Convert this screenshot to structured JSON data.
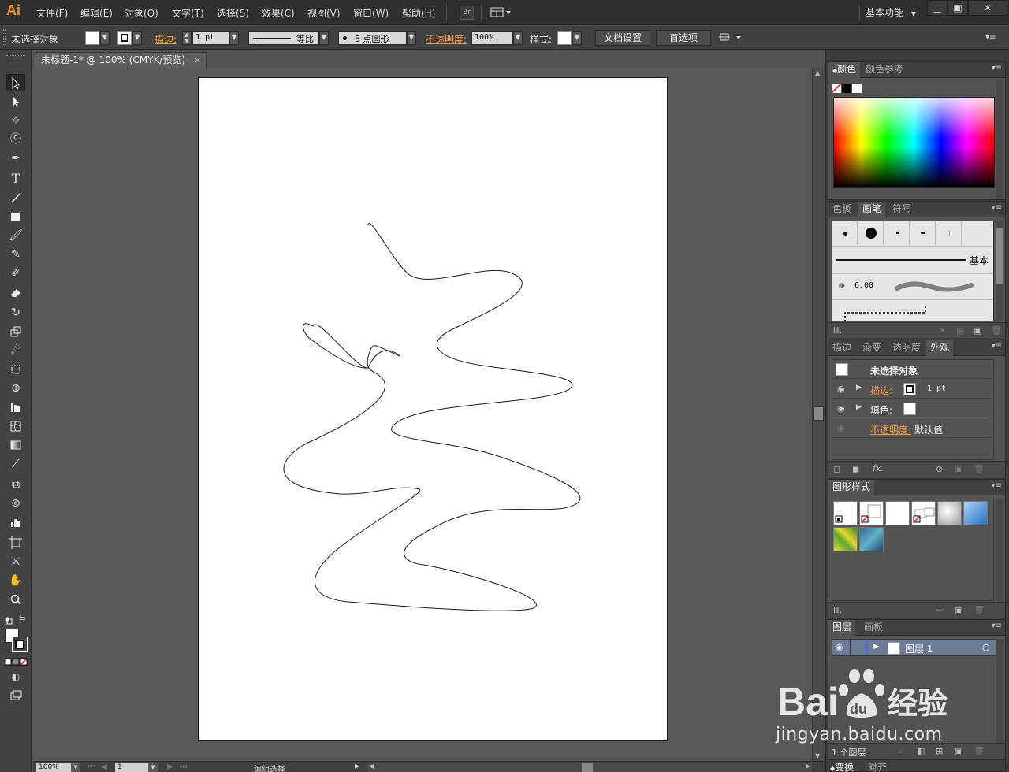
{
  "app": {
    "logo": "Ai",
    "menu": [
      "文件(F)",
      "编辑(E)",
      "对象(O)",
      "文字(T)",
      "选择(S)",
      "效果(C)",
      "视图(V)",
      "窗口(W)",
      "帮助(H)"
    ],
    "bridge_button": "Br",
    "workspace": "基本功能",
    "window_controls": [
      "▁",
      "▣",
      "✕"
    ]
  },
  "control_bar": {
    "selection_label": "未选择对象",
    "stroke_label": "描边:",
    "stroke_weight": "1 pt",
    "stroke_profile": "等比",
    "brush_label": "5 点圆形",
    "opacity_label": "不透明度:",
    "opacity_value": "100%",
    "style_label": "样式:",
    "doc_setup_button": "文档设置",
    "preferences_button": "首选项"
  },
  "document": {
    "tab_title": "未标题-1* @ 100% (CMYK/预览)",
    "tab_close": "×",
    "artboard_color": "#ffffff",
    "path_description": "freeform closed stroke path"
  },
  "status_bar": {
    "zoom": "100%",
    "artboard_number": "1",
    "status_text": "编组选择"
  },
  "panels": {
    "color": {
      "tabs": [
        "颜色",
        "颜色参考"
      ],
      "active_tab": 0
    },
    "brushes": {
      "tabs": [
        "色板",
        "画笔",
        "符号"
      ],
      "active_tab": 1,
      "basic_label": "基本",
      "size_value": "6.00"
    },
    "appearance": {
      "tabs": [
        "描边",
        "渐变",
        "透明度",
        "外观"
      ],
      "active_tab": 3,
      "object_label": "未选择对象",
      "stroke_label": "描边:",
      "stroke_value": "1 pt",
      "fill_label": "填色:",
      "opacity_label": "不透明度:",
      "opacity_value": "默认值",
      "fx_label": "fx."
    },
    "graphic_styles": {
      "title": "图形样式"
    },
    "layers": {
      "tabs": [
        "图层",
        "画板"
      ],
      "active_tab": 0,
      "layer_name": "图层 1",
      "layer_count": "1 个图层",
      "layer_color": "#4a6fd0"
    },
    "transform": {
      "tabs": [
        "变换",
        "对齐"
      ]
    }
  },
  "watermark": {
    "url": "jingyan.baidu.com",
    "text_left": "Bai",
    "text_right": "经验",
    "du": "du"
  },
  "colors": {
    "accent_orange": "#f39c3c",
    "app_logo": "#f7931e",
    "baidu_blue": "#ffffff"
  }
}
